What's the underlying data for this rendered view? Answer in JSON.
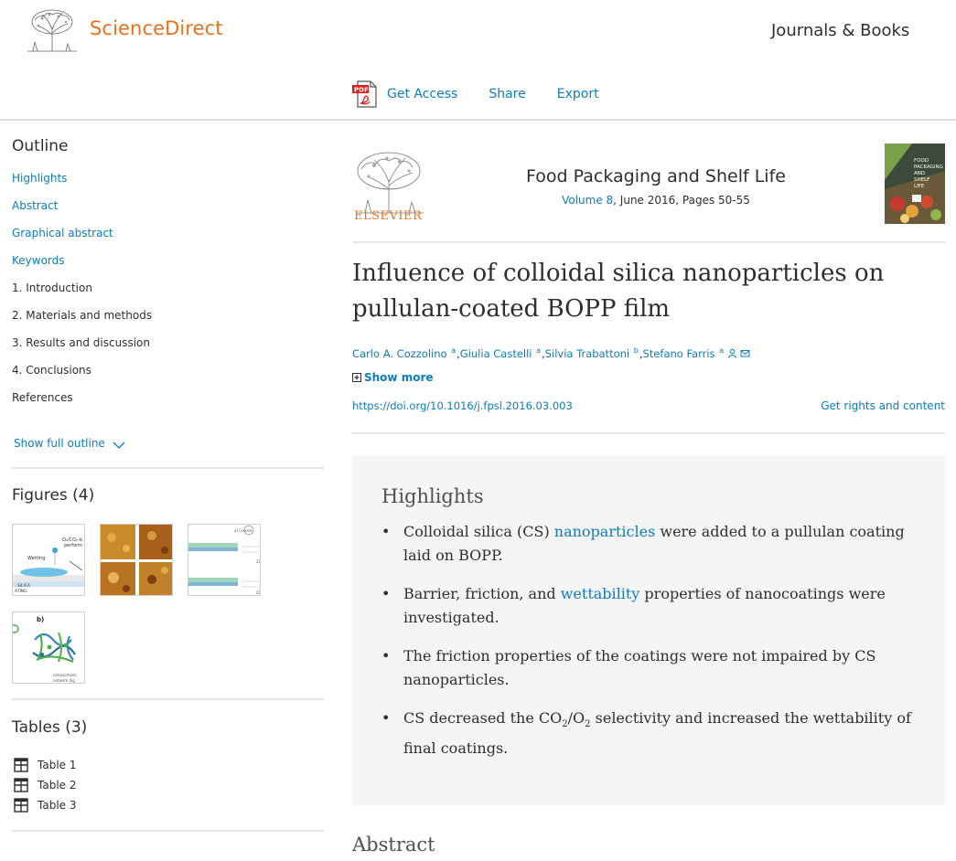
{
  "header": {
    "brand": "ScienceDirect",
    "journals_books": "Journals & Books",
    "toolbar": {
      "get_access": "Get Access",
      "share": "Share",
      "export": "Export"
    }
  },
  "sidebar": {
    "outline_heading": "Outline",
    "outline": [
      {
        "label": "Highlights",
        "link": true
      },
      {
        "label": "Abstract",
        "link": true
      },
      {
        "label": "Graphical abstract",
        "link": true
      },
      {
        "label": "Keywords",
        "link": true
      },
      {
        "label": "1. Introduction",
        "link": false
      },
      {
        "label": "2. Materials and methods",
        "link": false
      },
      {
        "label": "3. Results and discussion",
        "link": false
      },
      {
        "label": "4. Conclusions",
        "link": false
      },
      {
        "label": "References",
        "link": false
      }
    ],
    "show_full_outline": "Show full outline",
    "figures_heading": "Figures (4)",
    "tables_heading": "Tables (3)",
    "tables": [
      "Table 1",
      "Table 2",
      "Table 3"
    ]
  },
  "journal": {
    "publisher": "ELSEVIER",
    "title": "Food Packaging and Shelf Life",
    "volume_link": "Volume 8",
    "volume_rest": ", June 2016, Pages 50-55",
    "cover_text": "FOOD PACKAGING AND SHELF LIFE"
  },
  "article": {
    "title": "Influence of colloidal silica nanoparticles on pullulan-coated BOPP film",
    "authors": [
      {
        "name": "Carlo A. Cozzolino",
        "aff": "a"
      },
      {
        "name": "Giulia Castelli",
        "aff": "a"
      },
      {
        "name": "Silvia Trabattoni",
        "aff": "b"
      },
      {
        "name": "Stefano Farris",
        "aff": "a"
      }
    ],
    "show_more": "Show more",
    "doi": "https://doi.org/10.1016/j.fpsl.2016.03.003",
    "rights": "Get rights and content"
  },
  "highlights": {
    "heading": "Highlights",
    "h1_a": "Colloidal silica (CS) ",
    "h1_link": "nanoparticles",
    "h1_b": " were added to a pullulan coating laid on BOPP.",
    "h2_a": "Barrier, friction, and ",
    "h2_link": "wettability",
    "h2_b": " properties of nanocoatings were investigated.",
    "h3": "The friction properties of the coatings were not impaired by CS nanoparticles.",
    "h4_a": "CS decreased the CO",
    "h4_sub1": "2",
    "h4_b": "/O",
    "h4_sub2": "2",
    "h4_c": " selectivity and increased the wettability of final coatings."
  },
  "abstract_heading": "Abstract",
  "colors": {
    "brand_orange": "#e9711c",
    "link_blue": "#0c7dbb",
    "highlight_bg": "#f5f5f5"
  }
}
